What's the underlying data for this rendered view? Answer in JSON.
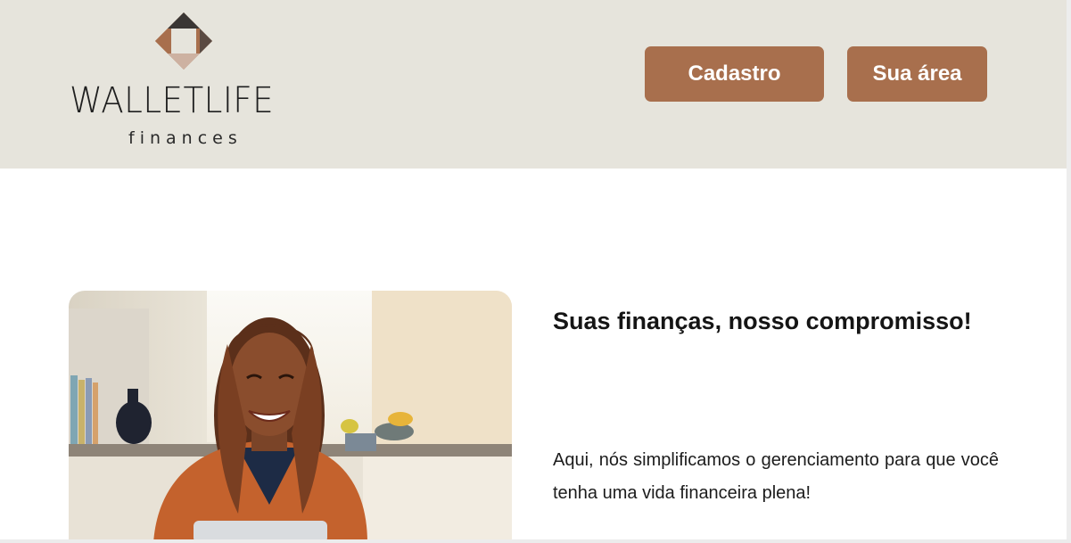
{
  "brand": {
    "name": "WALLETLIFE",
    "tagline": "finances",
    "colors": {
      "dark": "#3a3634",
      "accent": "#a86f4d",
      "light": "#cdb1a1"
    }
  },
  "nav": {
    "cadastro_label": "Cadastro",
    "area_label": "Sua área"
  },
  "hero": {
    "image_icon": "smiling-woman-photo",
    "headline": "Suas finanças, nosso compromisso!",
    "description": "Aqui, nós simplificamos o gerenciamento para que você tenha uma vida financeira plena!"
  },
  "colors": {
    "header_bg": "#e6e4dc",
    "button_bg": "#a86f4d",
    "button_text": "#ffffff"
  }
}
